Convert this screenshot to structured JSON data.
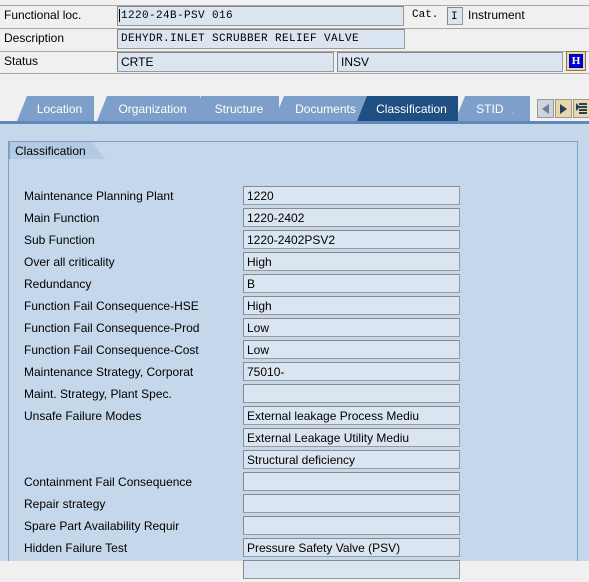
{
  "header": {
    "rows": [
      {
        "label": "Functional loc.",
        "value": "1220-24B-PSV  016"
      },
      {
        "label": "Description",
        "value": "DEHYDR.INLET SCRUBBER RELIEF VALVE"
      },
      {
        "label": "Status",
        "value": "CRTE",
        "value2": "INSV"
      }
    ],
    "category_label": "Cat.",
    "category_value": "I",
    "category_text": "Instrument",
    "info_icon": "information-icon",
    "info_glyph": "H"
  },
  "tabs": [
    {
      "label": "Location",
      "active": false
    },
    {
      "label": "Organization",
      "active": false
    },
    {
      "label": "Structure",
      "active": false
    },
    {
      "label": "Documents",
      "active": false
    },
    {
      "label": "Classification",
      "active": true
    },
    {
      "label": "STID ...",
      "active": false
    }
  ],
  "tab_nav": {
    "prev_icon": "arrow-left-icon",
    "next_icon": "arrow-right-icon",
    "list_icon": "tab-list-icon"
  },
  "group": {
    "title": "Classification"
  },
  "form": {
    "rows": [
      {
        "label": "Maintenance Planning Plant",
        "value": "1220"
      },
      {
        "label": "Main Function",
        "value": "1220-2402"
      },
      {
        "label": "Sub Function",
        "value": "1220-2402PSV2"
      },
      {
        "label": "Over all criticality",
        "value": "High"
      },
      {
        "label": "Redundancy",
        "value": "B"
      },
      {
        "label": "Function Fail Consequence-HSE",
        "value": "High"
      },
      {
        "label": "Function Fail Consequence-Prod",
        "value": "Low"
      },
      {
        "label": "Function Fail Consequence-Cost",
        "value": "Low"
      },
      {
        "label": "Maintenance Strategy, Corporat",
        "value": "75010-"
      },
      {
        "label": "Maint. Strategy, Plant  Spec.",
        "value": ""
      },
      {
        "label": "Unsafe Failure Modes",
        "value": "External leakage Process Mediu"
      },
      {
        "label": "",
        "value": "External Leakage Utility Mediu"
      },
      {
        "label": "",
        "value": "Structural deficiency"
      },
      {
        "label": "Containment Fail Consequence",
        "value": ""
      },
      {
        "label": "Repair strategy",
        "value": ""
      },
      {
        "label": "Spare Part Availability Requir",
        "value": ""
      },
      {
        "label": "Hidden Failure Test",
        "value": "Pressure Safety Valve (PSV)"
      },
      {
        "label": "",
        "value": ""
      }
    ]
  },
  "colors": {
    "panel_bg": "#c5d7ea",
    "field_bg": "#dbe5f1",
    "tab_active": "#1f4f82",
    "tab_inactive": "#7e9fc9",
    "window_bg": "#f0f0f0"
  }
}
